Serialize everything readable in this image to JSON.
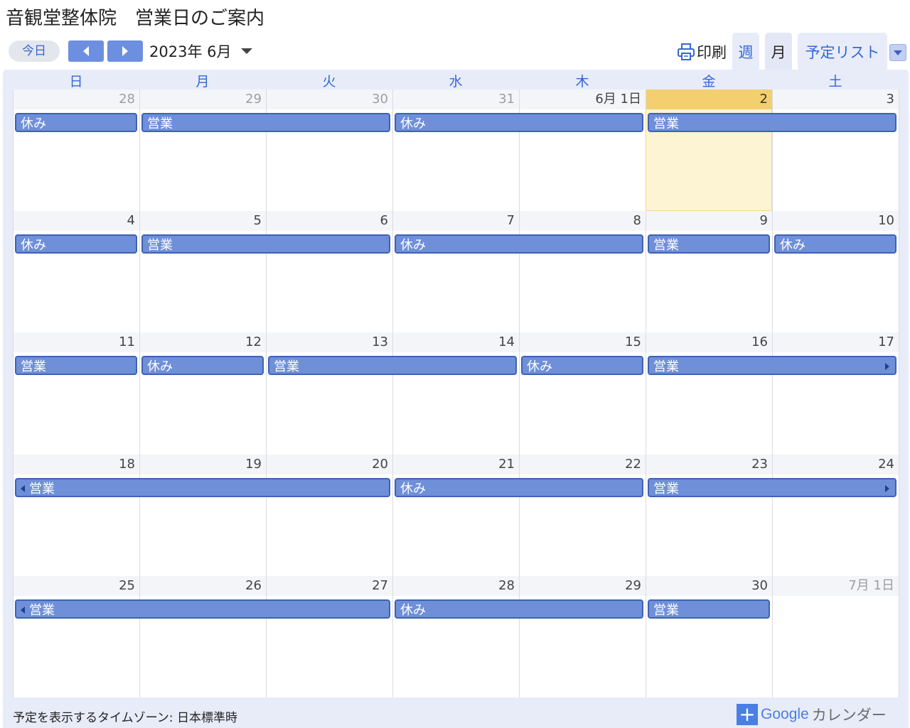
{
  "page_title": "音観堂整体院　営業日のご案内",
  "toolbar": {
    "today_label": "今日",
    "current_month": "2023年 6月",
    "print_label": "印刷",
    "tabs": [
      {
        "id": "week",
        "label": "週"
      },
      {
        "id": "month",
        "label": "月",
        "selected": true
      },
      {
        "id": "agenda",
        "label": "予定リスト"
      }
    ]
  },
  "weekdays": [
    "日",
    "月",
    "火",
    "水",
    "木",
    "金",
    "土"
  ],
  "weeks": [
    {
      "days": [
        "28",
        "29",
        "30",
        "31",
        "6月 1日",
        "2",
        "3"
      ],
      "outside": [
        0,
        1,
        2,
        3
      ],
      "today": 5,
      "events": [
        {
          "label": "休み",
          "start": 0,
          "span": 1
        },
        {
          "label": "営業",
          "start": 1,
          "span": 2
        },
        {
          "label": "休み",
          "start": 3,
          "span": 2
        },
        {
          "label": "営業",
          "start": 5,
          "span": 2
        }
      ]
    },
    {
      "days": [
        "4",
        "5",
        "6",
        "7",
        "8",
        "9",
        "10"
      ],
      "outside": [],
      "events": [
        {
          "label": "休み",
          "start": 0,
          "span": 1
        },
        {
          "label": "営業",
          "start": 1,
          "span": 2
        },
        {
          "label": "休み",
          "start": 3,
          "span": 2
        },
        {
          "label": "営業",
          "start": 5,
          "span": 1
        },
        {
          "label": "休み",
          "start": 6,
          "span": 1
        }
      ]
    },
    {
      "days": [
        "11",
        "12",
        "13",
        "14",
        "15",
        "16",
        "17"
      ],
      "outside": [],
      "events": [
        {
          "label": "営業",
          "start": 0,
          "span": 1
        },
        {
          "label": "休み",
          "start": 1,
          "span": 1
        },
        {
          "label": "営業",
          "start": 2,
          "span": 2
        },
        {
          "label": "休み",
          "start": 4,
          "span": 1
        },
        {
          "label": "営業",
          "start": 5,
          "span": 2,
          "continues_right": true
        }
      ]
    },
    {
      "days": [
        "18",
        "19",
        "20",
        "21",
        "22",
        "23",
        "24"
      ],
      "outside": [],
      "events": [
        {
          "label": "営業",
          "start": 0,
          "span": 3,
          "continues_left": true
        },
        {
          "label": "休み",
          "start": 3,
          "span": 2
        },
        {
          "label": "営業",
          "start": 5,
          "span": 2,
          "continues_right": true
        }
      ]
    },
    {
      "days": [
        "25",
        "26",
        "27",
        "28",
        "29",
        "30",
        "7月 1日"
      ],
      "outside": [
        6
      ],
      "events": [
        {
          "label": "営業",
          "start": 0,
          "span": 3,
          "continues_left": true
        },
        {
          "label": "休み",
          "start": 3,
          "span": 2
        },
        {
          "label": "営業",
          "start": 5,
          "span": 1
        }
      ]
    }
  ],
  "footer": {
    "timezone_note": "予定を表示するタイムゾーン: 日本標準時",
    "gcal_plus": "+",
    "gcal_brand": "Google",
    "gcal_product": "カレンダー"
  },
  "colors": {
    "accent": "#3367d6",
    "event_fill": "#6f8fd9",
    "event_border": "#3e62b4",
    "today_header": "#f3cf70",
    "today_fill": "#fdf4d3",
    "frame": "#e8ecf9"
  },
  "icons": [
    "chevron-left-icon",
    "chevron-right-icon",
    "dropdown-arrow-icon",
    "printer-icon",
    "google-calendar-plus-icon"
  ]
}
